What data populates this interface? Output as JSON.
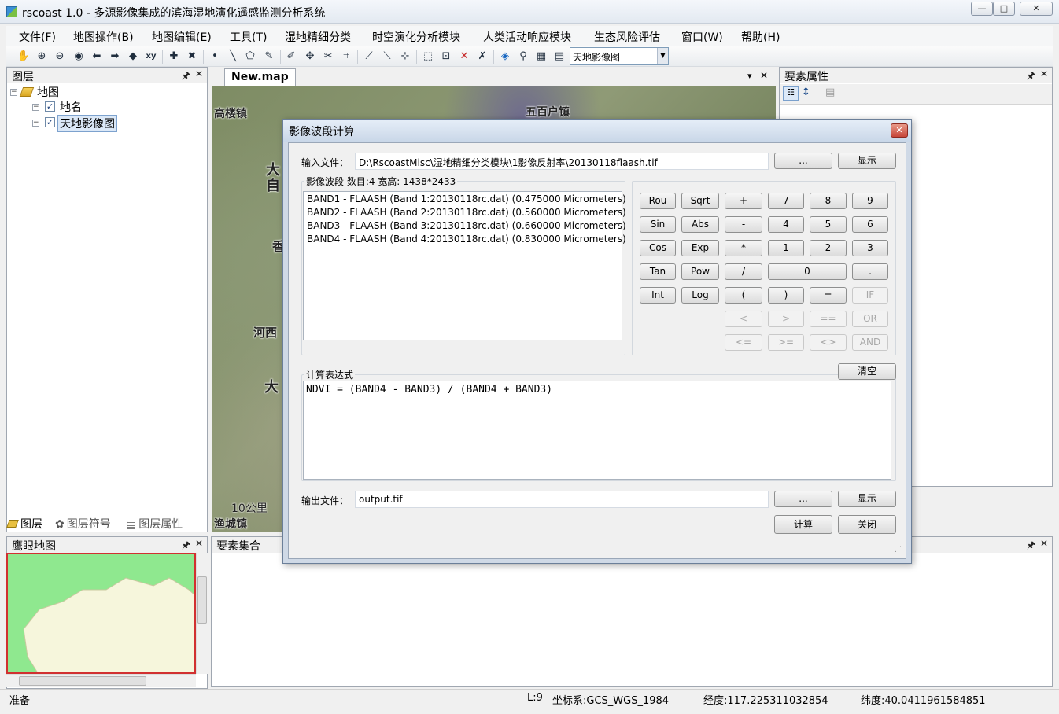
{
  "window": {
    "title": "rscoast 1.0 - 多源影像集成的滨海湿地演化遥感监测分析系统",
    "minimize_glyph": "—",
    "maximize_glyph": "□",
    "close_glyph": "✕"
  },
  "menu": {
    "items": [
      "文件(F)",
      "地图操作(B)",
      "地图编辑(E)",
      "工具(T)",
      "湿地精细分类",
      "时空演化分析模块",
      "人类活动响应模块",
      "生态风险评估",
      "窗口(W)",
      "帮助(H)"
    ]
  },
  "toolbar": {
    "icons": [
      "pan-icon",
      "zoom-in-icon",
      "zoom-out-icon",
      "full-extent-icon",
      "back-icon",
      "forward-icon",
      "identify-icon",
      "xy-locate-icon",
      "add-layer-icon",
      "remove-layer-icon",
      "point-icon",
      "line-icon",
      "polygon-icon",
      "edit-icon",
      "sketch-icon",
      "move-icon",
      "cut-icon",
      "vertex-icon",
      "split-icon",
      "reshape-icon",
      "merge-icon",
      "select-icon",
      "clear-select-icon",
      "delete-icon",
      "union-icon",
      "locate-icon",
      "binoculars-icon",
      "measure-icon",
      "table-icon"
    ],
    "glyphs": [
      "✋",
      "⊕",
      "⊖",
      "◉",
      "⬅",
      "➡",
      "◆",
      "xy",
      "✚",
      "✖",
      "•",
      "╲",
      "⬠",
      "✎",
      "✐",
      "✥",
      "✂",
      "⌗",
      "⟋",
      "⟍",
      "⊹",
      "⬚",
      "⊡",
      "✕",
      "✗",
      "◈",
      "⚲",
      "▦",
      "▤"
    ],
    "layer_select_value": "天地影像图",
    "dropdown_glyph": "▼"
  },
  "layers_panel": {
    "title": "图层",
    "pin_glyph": "🖈",
    "close_glyph": "✕",
    "tree": {
      "root": "地图",
      "children": [
        "地名",
        "天地影像图"
      ]
    },
    "expander_glyph": "−",
    "check_glyph": "✓",
    "tabs": [
      "图层",
      "图层符号",
      "图层属性"
    ]
  },
  "map_tab": {
    "label": "New.map",
    "menu_glyph": "▾",
    "close_glyph": "✕"
  },
  "map_labels": [
    "高楼镇",
    "五百户镇",
    "大",
    "自",
    "香",
    "河西",
    "大",
    "10公里",
    "渔城镇"
  ],
  "properties_panel": {
    "title": "要素属性"
  },
  "overview_panel": {
    "title": "鹰眼地图"
  },
  "feature_set_panel": {
    "title": "要素集合"
  },
  "dialog": {
    "title": "影像波段计算",
    "close_glyph": "✕",
    "input_file_label": "输入文件：",
    "input_file_value": "D:\\RscoastMisc\\湿地精细分类模块\\1影像反射率\\20130118flaash.tif",
    "browse_label": "...",
    "show_label": "显示",
    "bands_group_title": "影像波段  数目:4  宽高: 1438*2433",
    "bands": [
      "BAND1 - FLAASH (Band 1:20130118rc.dat) (0.475000 Micrometers)",
      "BAND2 - FLAASH (Band 2:20130118rc.dat) (0.560000 Micrometers)",
      "BAND3 - FLAASH (Band 3:20130118rc.dat) (0.660000 Micrometers)",
      "BAND4 - FLAASH (Band 4:20130118rc.dat) (0.830000 Micrometers)"
    ],
    "calc_buttons": {
      "row1": [
        "Rou",
        "Sqrt",
        "+",
        "7",
        "8",
        "9"
      ],
      "row2": [
        "Sin",
        "Abs",
        "-",
        "4",
        "5",
        "6"
      ],
      "row3": [
        "Cos",
        "Exp",
        "*",
        "1",
        "2",
        "3"
      ],
      "row4": [
        "Tan",
        "Pow",
        "/",
        "0",
        "."
      ],
      "row5": [
        "Int",
        "Log",
        "(",
        ")",
        "=",
        "IF"
      ],
      "row6": [
        "<",
        ">",
        "==",
        "OR"
      ],
      "row7": [
        "<=",
        ">=",
        "<>",
        "AND"
      ]
    },
    "expression_label": "计算表达式",
    "clear_label": "清空",
    "expression": "NDVI = (BAND4 - BAND3) / (BAND4 + BAND3)",
    "output_file_label": "输出文件：",
    "output_file_value": "output.tif",
    "compute_label": "计算",
    "close_label": "关闭"
  },
  "status": {
    "ready": "准备",
    "level": "L:9",
    "crs": "坐标系:GCS_WGS_1984",
    "longitude": "经度:117.225311032854",
    "latitude": "纬度:40.0411961584851"
  }
}
